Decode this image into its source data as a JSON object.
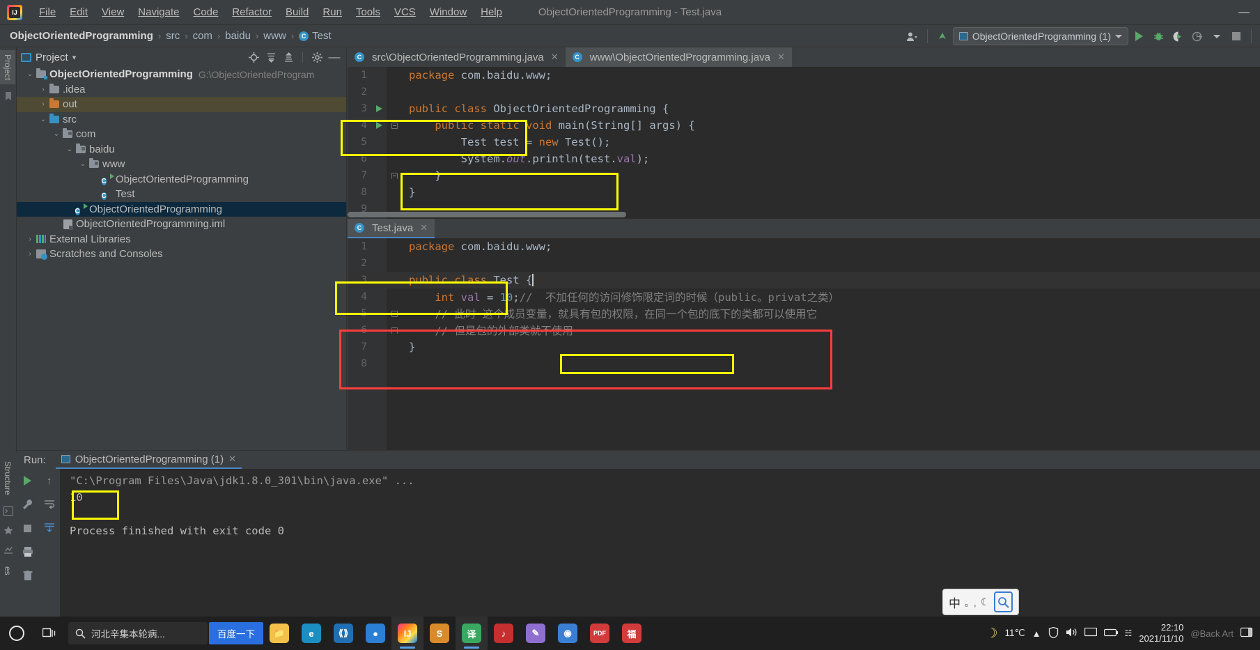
{
  "window": {
    "title": "ObjectOrientedProgramming - Test.java",
    "minimize": "—",
    "maximize": "□",
    "close": "✕"
  },
  "menubar": [
    {
      "label": "File"
    },
    {
      "label": "Edit"
    },
    {
      "label": "View"
    },
    {
      "label": "Navigate"
    },
    {
      "label": "Code"
    },
    {
      "label": "Refactor"
    },
    {
      "label": "Build"
    },
    {
      "label": "Run"
    },
    {
      "label": "Tools"
    },
    {
      "label": "VCS"
    },
    {
      "label": "Window"
    },
    {
      "label": "Help"
    }
  ],
  "breadcrumb": {
    "items": [
      "ObjectOrientedProgramming",
      "src",
      "com",
      "baidu",
      "www",
      "Test"
    ],
    "class_badge": "C",
    "separator": "›"
  },
  "toolbar_right": {
    "run_config": "ObjectOrientedProgramming (1)",
    "account_icon": "account-icon",
    "update_icon": "update-arrow-icon",
    "run_icon": "run-icon",
    "debug_icon": "debug-icon",
    "coverage_icon": "run-with-coverage-icon",
    "profiler_icon": "profiler-icon",
    "stop_icon": "stop-icon",
    "dropdown_caret": "▾"
  },
  "left_strip": {
    "project_tab": "Project",
    "structure_tab": "Structure",
    "favorites_tab": "es"
  },
  "project_panel": {
    "title": "Project",
    "dropdown": "▾",
    "actions": [
      "locate-icon",
      "expand-all-icon",
      "collapse-all-icon",
      "settings-icon",
      "hide-icon"
    ],
    "tree": [
      {
        "depth": 0,
        "arrow": "⌄",
        "icon": "module-folder",
        "label": "ObjectOrientedProgramming",
        "bold": true,
        "path": "G:\\ObjectOrientedProgram",
        "state": "normal"
      },
      {
        "depth": 1,
        "arrow": "›",
        "icon": "folder-gray",
        "label": ".idea",
        "bold": false,
        "path": "",
        "state": "normal"
      },
      {
        "depth": 1,
        "arrow": "›",
        "icon": "folder-orange",
        "label": "out",
        "bold": false,
        "path": "",
        "state": "out-sel"
      },
      {
        "depth": 1,
        "arrow": "⌄",
        "icon": "folder-blue",
        "label": "src",
        "bold": false,
        "path": "",
        "state": "normal"
      },
      {
        "depth": 2,
        "arrow": "⌄",
        "icon": "package",
        "label": "com",
        "bold": false,
        "path": "",
        "state": "normal"
      },
      {
        "depth": 3,
        "arrow": "⌄",
        "icon": "package",
        "label": "baidu",
        "bold": false,
        "path": "",
        "state": "normal"
      },
      {
        "depth": 4,
        "arrow": "⌄",
        "icon": "package",
        "label": "www",
        "bold": false,
        "path": "",
        "state": "normal"
      },
      {
        "depth": 5,
        "arrow": "",
        "icon": "class-runnable",
        "label": "ObjectOrientedProgramming",
        "bold": false,
        "path": "",
        "state": "normal"
      },
      {
        "depth": 5,
        "arrow": "",
        "icon": "class",
        "label": "Test",
        "bold": false,
        "path": "",
        "state": "normal"
      },
      {
        "depth": 3,
        "arrow": "",
        "icon": "class-runnable",
        "label": "ObjectOrientedProgramming",
        "bold": false,
        "path": "",
        "state": "selected"
      },
      {
        "depth": 2,
        "arrow": "",
        "icon": "iml-file",
        "label": "ObjectOrientedProgramming.iml",
        "bold": false,
        "path": "",
        "state": "normal"
      },
      {
        "depth": 0,
        "arrow": "›",
        "icon": "library",
        "label": "External Libraries",
        "bold": false,
        "path": "",
        "state": "normal"
      },
      {
        "depth": 0,
        "arrow": "›",
        "icon": "scratches",
        "label": "Scratches and Consoles",
        "bold": false,
        "path": "",
        "state": "normal"
      }
    ]
  },
  "editor_top": {
    "tabs": [
      {
        "label": "src\\ObjectOrientedProgramming.java",
        "active": false,
        "icon": "java-class-icon",
        "close": "✕"
      },
      {
        "label": "www\\ObjectOrientedProgramming.java",
        "active": true,
        "icon": "java-class-icon",
        "close": "✕"
      }
    ],
    "lines": [
      {
        "n": "1",
        "marker": "",
        "fold": false,
        "html": "<span class='kw'>package</span> com.baidu.www;"
      },
      {
        "n": "2",
        "marker": "",
        "fold": false,
        "html": ""
      },
      {
        "n": "3",
        "marker": "run",
        "fold": false,
        "html": "<span class='kw'>public</span> <span class='kw'>class</span> ObjectOrientedProgramming {"
      },
      {
        "n": "4",
        "marker": "run",
        "fold": true,
        "html": "    <span class='kw'>public</span> <span class='kw'>static</span> <span class='kw'>void</span> main(String[] args) {"
      },
      {
        "n": "5",
        "marker": "",
        "fold": false,
        "html": "        Test test = <span class='kw'>new</span> Test();"
      },
      {
        "n": "6",
        "marker": "",
        "fold": false,
        "html": "        System.<span class='sfield'>out</span>.println(test.<span class='fld'>val</span>);"
      },
      {
        "n": "7",
        "marker": "",
        "fold": "end",
        "html": "    }"
      },
      {
        "n": "8",
        "marker": "",
        "fold": false,
        "html": "}"
      },
      {
        "n": "9",
        "marker": "",
        "fold": false,
        "html": ""
      }
    ]
  },
  "editor_bottom": {
    "tabs": [
      {
        "label": "Test.java",
        "active": true,
        "icon": "java-class-icon",
        "close": "✕"
      }
    ],
    "lines": [
      {
        "n": "1",
        "marker": "",
        "fold": false,
        "html": "<span class='kw'>package</span> com.baidu.www;"
      },
      {
        "n": "2",
        "marker": "",
        "fold": false,
        "html": ""
      },
      {
        "n": "3",
        "marker": "",
        "fold": false,
        "html": "<span class='kw'>public</span> <span class='kw'>class</span> Test {<span class='caret-blk'></span>"
      },
      {
        "n": "4",
        "marker": "",
        "fold": false,
        "html": "    <span class='kw'>int</span> <span class='fld'>val</span> = <span class='num'>10</span>;<span class='cmt'>//  不加任何的访问修饰限定词的时候（public。privat之类）</span>"
      },
      {
        "n": "5",
        "marker": "",
        "fold": true,
        "html": "    <span class='cmt'>// 此时 这个成员变量，就具有包的权限，在同一个包的底下的类都可以使用它</span>"
      },
      {
        "n": "6",
        "marker": "",
        "fold": "end",
        "html": "    <span class='cmt'>// 但是包的外部类就不使用</span>"
      },
      {
        "n": "7",
        "marker": "",
        "fold": false,
        "html": "}"
      },
      {
        "n": "8",
        "marker": "",
        "fold": false,
        "html": ""
      }
    ]
  },
  "run_panel": {
    "label": "Run:",
    "tab": "ObjectOrientedProgramming (1)",
    "close": "✕",
    "side_icons": [
      "run-icon",
      "up-arrow-icon",
      "wrench-icon",
      "stop-icon",
      "trash-icon",
      "print-icon",
      "scroll-to-end-icon",
      "soft-wrap-icon"
    ],
    "console": [
      {
        "text": "\"C:\\Program Files\\Java\\jdk1.8.0_301\\bin\\java.exe\" ...",
        "type": "cmd"
      },
      {
        "text": "10",
        "type": "out"
      },
      {
        "text": "",
        "type": "out"
      },
      {
        "text": "Process finished with exit code 0",
        "type": "out"
      }
    ]
  },
  "ime": {
    "mode": "中",
    "punct": "。,",
    "moon": "☾",
    "search_icon": "search-icon"
  },
  "taskbar": {
    "start_icon": "windows-start-icon",
    "taskview_icon": "task-view-icon",
    "search_icon": "search-icon",
    "search_text": "河北辛集本轮病...",
    "baidu_button": "百度一下",
    "apps": [
      {
        "name": "file-explorer-icon",
        "glyph": "📁",
        "bg": "#f3c14a",
        "fg": "#3a2c00"
      },
      {
        "name": "edge-browser-icon",
        "glyph": "e",
        "bg": "#1b8ec2",
        "fg": "#ffffff"
      },
      {
        "name": "vscode-icon",
        "glyph": "⬡",
        "bg": "#1f6fb2",
        "fg": "#ffffff"
      },
      {
        "name": "browser-icon",
        "glyph": "●",
        "bg": "#2b7fd4",
        "fg": "#ffffff"
      },
      {
        "name": "intellij-idea-icon",
        "glyph": "IJ",
        "bg": "#cf3d74",
        "fg": "#ffffff",
        "active": true
      },
      {
        "name": "sublime-text-icon",
        "glyph": "S",
        "bg": "#d98b2b",
        "fg": "#ffffff"
      },
      {
        "name": "translate-icon",
        "glyph": "译",
        "bg": "#3aa860",
        "fg": "#ffffff",
        "active": true
      },
      {
        "name": "netease-music-icon",
        "glyph": "♪",
        "bg": "#c62f2f",
        "fg": "#ffffff"
      },
      {
        "name": "editor-icon",
        "glyph": "✎",
        "bg": "#8e6fd0",
        "fg": "#ffffff"
      },
      {
        "name": "chrome-icon",
        "glyph": "◉",
        "bg": "#3b7fd4",
        "fg": "#ffffff"
      },
      {
        "name": "pdf-reader-icon",
        "glyph": "PDF",
        "bg": "#d23b3b",
        "fg": "#ffffff"
      },
      {
        "name": "app-icon",
        "glyph": "福",
        "bg": "#d23b3b",
        "fg": "#ffffff"
      }
    ],
    "weather_icon": "moon-weather-icon",
    "temperature": "11℃",
    "tray": [
      "caret-up-icon",
      "shield-icon",
      "volume-icon",
      "display-icon",
      "battery-icon",
      "network-icon"
    ],
    "time": "22:10",
    "date": "2021/11/10",
    "watermark": "@Back Art",
    "notify_icon": "notification-icon"
  }
}
